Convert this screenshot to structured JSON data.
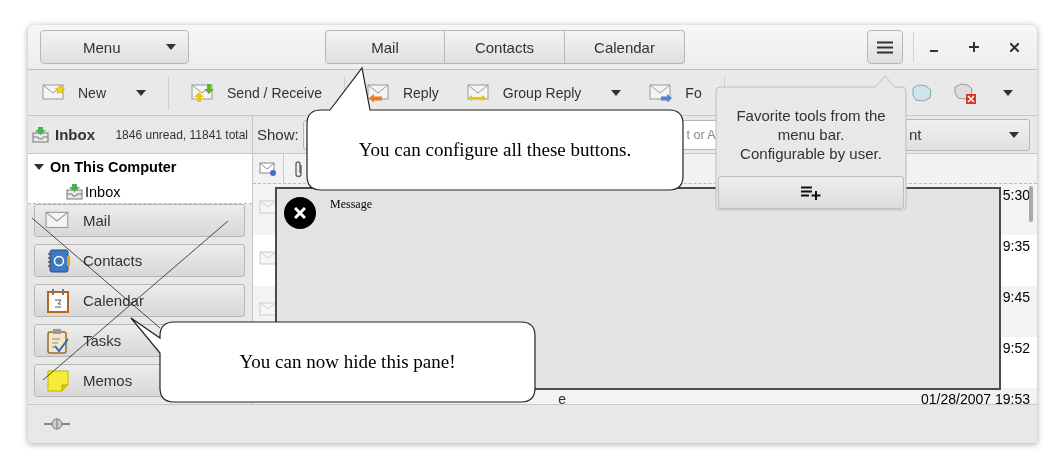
{
  "header": {
    "menu_button": "Menu",
    "view_switcher": [
      "Mail",
      "Contacts",
      "Calendar"
    ]
  },
  "toolbar": [
    {
      "kind": "button",
      "label": "New",
      "dropdown": true
    },
    {
      "kind": "separator"
    },
    {
      "kind": "button",
      "label": "Send / Receive",
      "dropdown": false
    },
    {
      "kind": "separator"
    },
    {
      "kind": "button",
      "label": "Reply",
      "dropdown": false
    },
    {
      "kind": "button",
      "label": "Group Reply",
      "dropdown": true
    },
    {
      "kind": "button",
      "label": "Fo",
      "dropdown": false
    },
    {
      "kind": "separator"
    },
    {
      "kind": "spacer"
    },
    {
      "kind": "icon"
    },
    {
      "kind": "icon"
    },
    {
      "kind": "menu"
    }
  ],
  "folder_bar": {
    "folder": "Inbox",
    "counts": "1846 unread, 11841 total"
  },
  "folder_tree": [
    {
      "label": "On This Computer",
      "expanded": true,
      "children": [
        {
          "label": "Inbox"
        }
      ]
    }
  ],
  "switcher": [
    "Mail",
    "Contacts",
    "Calendar",
    "Tasks",
    "Memos"
  ],
  "filter_bar": {
    "show_label": "Show:",
    "search_placeholder": "t or A",
    "scope": "nt"
  },
  "messages": [
    {
      "date": "5:30"
    },
    {
      "date": "9:35"
    },
    {
      "date": "9:45"
    },
    {
      "date": "9:52"
    },
    {
      "subject": "e",
      "date": "01/28/2007 19:53"
    }
  ],
  "message_preview": {
    "label": "Message"
  },
  "popover": {
    "lines": [
      "Favorite tools from the menu bar.",
      "Configurable by user."
    ]
  },
  "callouts": [
    "You can configure all these buttons.",
    "You can now hide this pane!"
  ]
}
